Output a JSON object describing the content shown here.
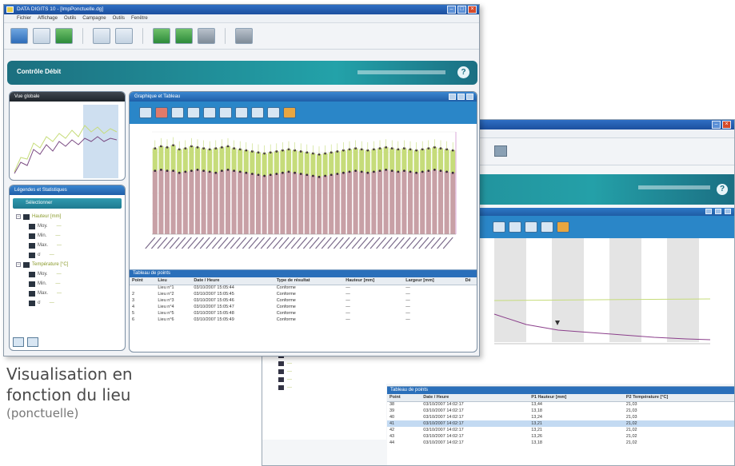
{
  "front_window": {
    "title": "DATA DIGITS 10 - [ImpPonctuelle.dg]",
    "menu": [
      "Fichier",
      "Affichage",
      "Outils",
      "Campagne",
      "Outils",
      "Fenêtre"
    ],
    "headband_title": "Contrôle Débit",
    "panels": {
      "apercu_title": "Vue globale",
      "legend_title": "Légendes et Statistiques",
      "legend_search": "Sélectionner",
      "graph_title": "Graphique et Tableau",
      "table_title": "Tableau de points"
    },
    "legend_tree": [
      {
        "label": "Hauteur [mm]",
        "kind": "group"
      },
      {
        "label": "Moy.",
        "value": "—"
      },
      {
        "label": "Min.",
        "value": "—"
      },
      {
        "label": "Max.",
        "value": "—"
      },
      {
        "label": "σ",
        "value": "—"
      },
      {
        "label": "Température [°C]",
        "kind": "group"
      },
      {
        "label": "Moy.",
        "value": "—"
      },
      {
        "label": "Min.",
        "value": "—"
      },
      {
        "label": "Max.",
        "value": "—"
      },
      {
        "label": "σ",
        "value": "—"
      }
    ],
    "table": {
      "headers": [
        "Point",
        "Lieu",
        "Date / Heure",
        "Type de résultat",
        "Hauteur [mm]",
        "Largeur [mm]",
        "Dé"
      ],
      "rows": [
        [
          "",
          "Lieu n°1",
          "03/10/2007 15:05:44",
          "Conforme",
          "—",
          "—",
          ""
        ],
        [
          "2",
          "Lieu n°2",
          "03/10/2007 15:05:45",
          "Conforme",
          "—",
          "—",
          ""
        ],
        [
          "3",
          "Lieu n°3",
          "03/10/2007 15:05:46",
          "Conforme",
          "—",
          "—",
          ""
        ],
        [
          "4",
          "Lieu n°4",
          "03/10/2007 15:05:47",
          "Conforme",
          "—",
          "—",
          ""
        ],
        [
          "5",
          "Lieu n°5",
          "03/10/2007 15:05:48",
          "Conforme",
          "—",
          "—",
          ""
        ],
        [
          "6",
          "Lieu n°6",
          "03/10/2007 15:05:49",
          "Conforme",
          "—",
          "—",
          ""
        ]
      ]
    }
  },
  "back_window": {
    "table_title": "Tableau de points",
    "table": {
      "headers": [
        "Point",
        "Date / Heure",
        "P1 Hauteur [mm]",
        "P2 Température [°C]"
      ],
      "rows": [
        [
          "38",
          "03/10/2007 14:02:17",
          "13,44",
          "21,03"
        ],
        [
          "39",
          "03/10/2007 14:02:17",
          "13,18",
          "21,03"
        ],
        [
          "40",
          "03/10/2007 14:02:17",
          "13,24",
          "21,03"
        ],
        [
          "41",
          "03/10/2007 14:02:17",
          "13,21",
          "21,02"
        ],
        [
          "42",
          "03/10/2007 14:02:17",
          "13,21",
          "21,02"
        ],
        [
          "43",
          "03/10/2007 14:02:17",
          "13,26",
          "21,02"
        ],
        [
          "44",
          "03/10/2007 14:02:17",
          "13,18",
          "21,02"
        ]
      ],
      "selected_row": 3
    }
  },
  "caption": {
    "line1": "Visualisation en",
    "line2": "fonction du lieu",
    "line3": "(ponctuelle)"
  },
  "chart_data": {
    "type": "bar",
    "series": [
      {
        "name": "",
        "values": [
          62,
          63,
          62,
          62,
          60,
          61,
          62,
          63,
          62,
          61,
          60,
          62,
          63,
          62,
          61,
          60,
          59,
          58,
          57,
          58,
          59,
          60,
          61,
          60,
          59,
          58,
          57,
          56,
          57,
          58,
          59,
          60,
          61,
          62,
          61,
          60,
          61,
          62,
          63,
          62,
          61,
          62,
          61,
          60,
          61,
          62,
          63,
          62,
          61,
          60
        ],
        "color": "#c8a0a6"
      },
      {
        "name": "",
        "values": [
          84,
          86,
          85,
          87,
          83,
          84,
          86,
          85,
          84,
          83,
          84,
          85,
          86,
          84,
          83,
          82,
          81,
          80,
          79,
          80,
          81,
          82,
          83,
          82,
          81,
          80,
          79,
          78,
          79,
          80,
          81,
          82,
          83,
          84,
          83,
          82,
          83,
          84,
          85,
          84,
          83,
          84,
          83,
          82,
          83,
          84,
          85,
          84,
          83,
          82
        ],
        "color": "#c6dc7a"
      }
    ],
    "ylim": [
      0,
      100
    ],
    "xlabel": "",
    "ylabel": "",
    "title": ""
  },
  "colors": {
    "teal_band": "#23a2a9",
    "panel_blue": "#2a86c8",
    "bar_pink": "#c8a0a6",
    "bar_green": "#c6dc7a",
    "line_purple": "#8b3f8b"
  }
}
